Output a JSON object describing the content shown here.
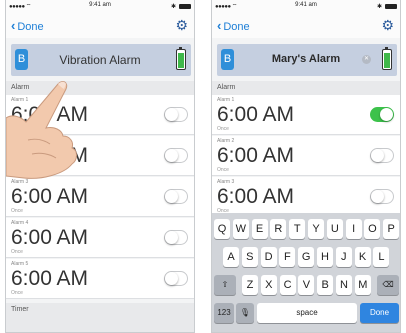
{
  "left": {
    "status": {
      "signal": "●●●●● ⌔",
      "time": "9:41 am",
      "bt": "✱"
    },
    "nav": {
      "back_label": "Done"
    },
    "device_name": "Vibration Alarm",
    "section_alarm": "Alarm",
    "section_timer": "Timer",
    "alarms": [
      {
        "label": "Alarm 1",
        "time": "6:00 AM",
        "repeat": "Once",
        "enabled": false
      },
      {
        "label": "Alarm 2",
        "time": "6:00 AM",
        "repeat": "Once",
        "enabled": false
      },
      {
        "label": "Alarm 3",
        "time": "6:00 AM",
        "repeat": "Once",
        "enabled": false
      },
      {
        "label": "Alarm 4",
        "time": "6:00 AM",
        "repeat": "Once",
        "enabled": false
      },
      {
        "label": "Alarm 5",
        "time": "6:00 AM",
        "repeat": "Once",
        "enabled": false
      }
    ]
  },
  "right": {
    "status": {
      "signal": "●●●●● ⌔",
      "time": "9:41 am",
      "bt": "✱"
    },
    "nav": {
      "back_label": "Done"
    },
    "device_name": "Mary's Alarm",
    "section_alarm": "Alarm",
    "alarms": [
      {
        "label": "Alarm 1",
        "time": "6:00 AM",
        "repeat": "Once",
        "enabled": true
      },
      {
        "label": "Alarm 2",
        "time": "6:00 AM",
        "repeat": "Once",
        "enabled": false
      },
      {
        "label": "Alarm 3",
        "time": "6:00 AM",
        "repeat": "Once",
        "enabled": false
      }
    ],
    "keyboard": {
      "row1": [
        "Q",
        "W",
        "E",
        "R",
        "T",
        "Y",
        "U",
        "I",
        "O",
        "P"
      ],
      "row2": [
        "A",
        "S",
        "D",
        "F",
        "G",
        "H",
        "J",
        "K",
        "L"
      ],
      "row3": [
        "Z",
        "X",
        "C",
        "V",
        "B",
        "N",
        "M"
      ],
      "shift": "⇧",
      "backspace": "⌫",
      "numbers": "123",
      "mic": "🎙",
      "space": "space",
      "done": "Done"
    }
  },
  "colors": {
    "accent": "#1e7fd6",
    "toggle_on": "#3cc24b",
    "bluetooth": "#2f8fd9",
    "name_bar": "#c5cfe0"
  }
}
